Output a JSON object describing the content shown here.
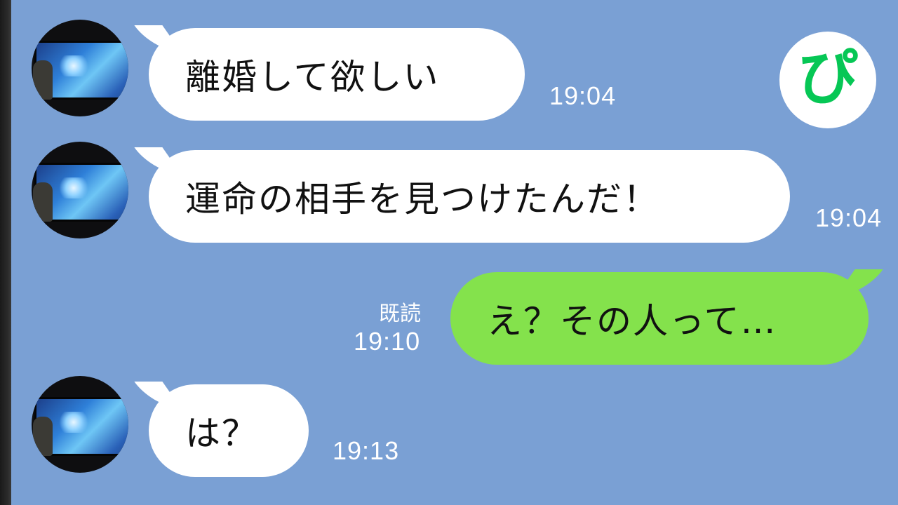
{
  "messages": [
    {
      "direction": "incoming",
      "text": "離婚して欲しい",
      "time": "19:04"
    },
    {
      "direction": "incoming",
      "text": "運命の相手を見つけたんだ！",
      "time": "19:04"
    },
    {
      "direction": "outgoing",
      "text": "え？その人って…",
      "read_label": "既読",
      "time": "19:10"
    },
    {
      "direction": "incoming",
      "text": "は？",
      "time": "19:13"
    }
  ],
  "logo": {
    "text": "ぴ",
    "color": "#06c755"
  },
  "colors": {
    "background": "#7aa0d4",
    "incoming_bubble": "#ffffff",
    "outgoing_bubble": "#84e24c"
  }
}
